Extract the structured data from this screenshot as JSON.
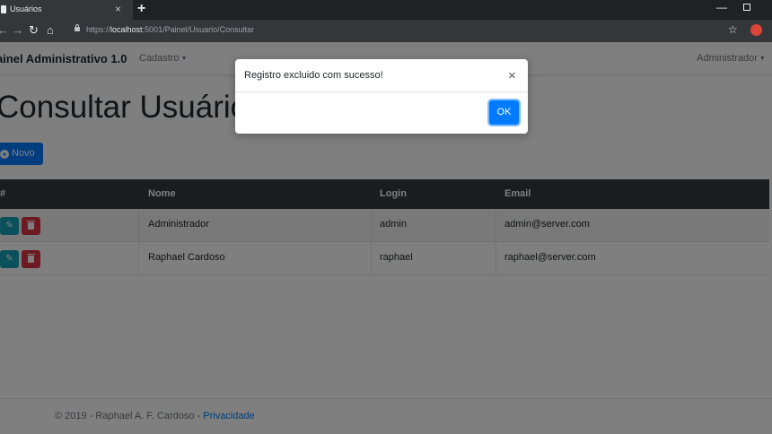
{
  "browser": {
    "tab_title": "Usuários",
    "tab_close": "×",
    "new_tab": "+",
    "url_prefix": "https://",
    "url_host": "localhost",
    "url_path": ":5001/Painel/Usuario/Consultar",
    "min_glyph": "—",
    "star_glyph": "☆"
  },
  "navbar": {
    "brand": "ainel Administrativo 1.0",
    "menu_cadastro": "Cadastro",
    "menu_admin": "Administrador"
  },
  "main": {
    "title": "Consultar Usuário",
    "new_button": "Novo"
  },
  "table": {
    "headers": [
      "#",
      "Nome",
      "Login",
      "Email"
    ],
    "rows": [
      {
        "nome": "Administrador",
        "login": "admin",
        "email": "admin@server.com"
      },
      {
        "nome": "Raphael Cardoso",
        "login": "raphael",
        "email": "raphael@server.com"
      }
    ]
  },
  "footer": {
    "text": "© 2019 - Raphael A. F. Cardoso - ",
    "link": "Privacidade"
  },
  "modal": {
    "message": "Registro excluido com sucesso!",
    "close": "×",
    "ok": "OK"
  },
  "colors": {
    "primary": "#007bff",
    "info": "#17a2b8",
    "danger": "#dc3545",
    "table_head": "#343a40"
  }
}
